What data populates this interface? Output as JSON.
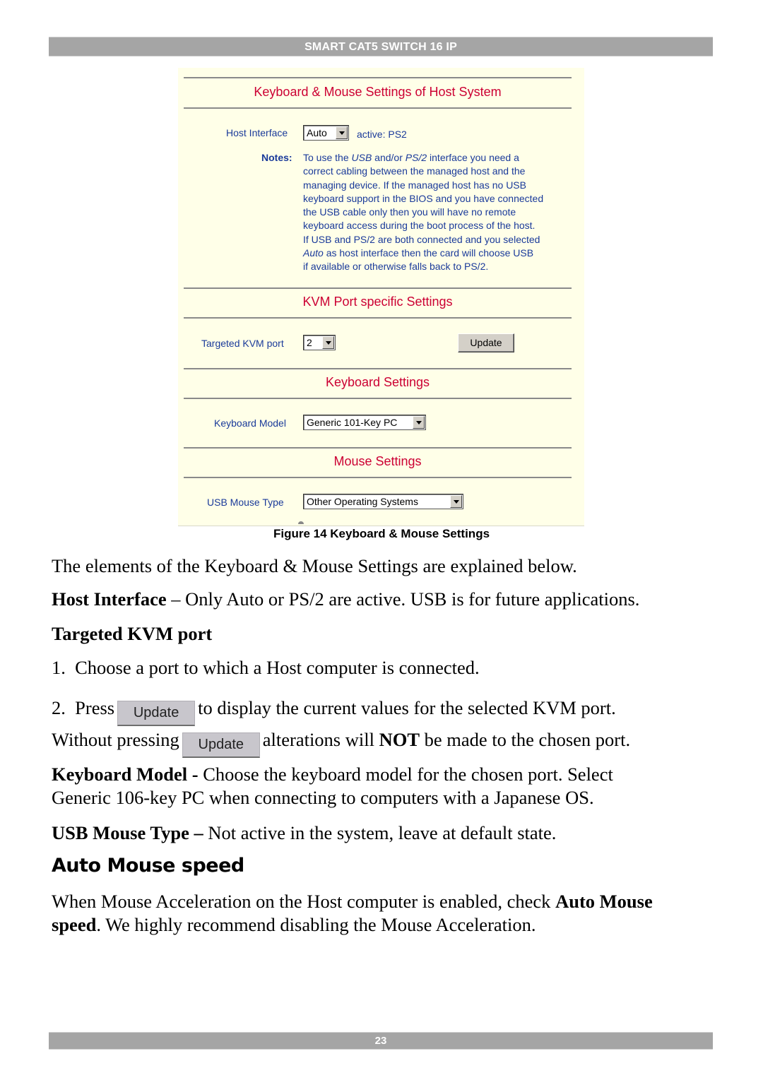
{
  "header": {
    "title": "SMART CAT5 SWITCH 16 IP"
  },
  "figure": {
    "sections": {
      "host": {
        "title": "Keyboard & Mouse Settings of Host System"
      },
      "kvm": {
        "title": "KVM Port specific Settings"
      },
      "keyboard": {
        "title": "Keyboard Settings"
      },
      "mouse": {
        "title": "Mouse Settings"
      }
    },
    "host_interface": {
      "label": "Host Interface",
      "value": "Auto",
      "active_text": "active: PS2"
    },
    "notes": {
      "label": "Notes:",
      "lines": [
        "To use the USB and/or PS/2 interface you need a",
        "correct cabling between the managed host and the",
        "managing device. If the managed host has no USB",
        "keyboard support in the BIOS and you have connected",
        "the USB cable only then you will have no remote",
        "keyboard access during the boot process of the host.",
        "If USB and PS/2 are both connected and you selected",
        "Auto as host interface then the card will choose USB",
        "if available or otherwise falls back to PS/2."
      ]
    },
    "targeted_kvm_port": {
      "label": "Targeted KVM port",
      "value": "2",
      "button_label": "Update"
    },
    "keyboard_model": {
      "label": "Keyboard Model",
      "value": "Generic 101-Key PC"
    },
    "usb_mouse_type": {
      "label": "USB Mouse Type",
      "value": "Other Operating Systems"
    },
    "caption": "Figure 14 Keyboard & Mouse Settings"
  },
  "body": {
    "intro": "The elements of the Keyboard & Mouse Settings are explained below.",
    "host_interface": {
      "term": "Host Interface",
      "text": " – Only Auto or PS/2 are active. USB is for future applications."
    },
    "targeted_heading": "Targeted KVM port",
    "step1": "1.  Choose a port to which a Host computer is connected.",
    "step2": {
      "prefix": "2.  Press",
      "button": "Update",
      "suffix": "to display the current values for the selected KVM port."
    },
    "without": {
      "prefix": "Without pressing",
      "button": "Update",
      "mid": "alterations will ",
      "bold": "NOT",
      "suffix": " be made to the chosen port."
    },
    "keyboard_model": {
      "term": "Keyboard Model - ",
      "line1": "Choose the keyboard model for the chosen port. Select",
      "line2": "Generic 106-key PC when connecting to computers with a Japanese OS."
    },
    "usb_mouse": {
      "term": "USB Mouse Type – ",
      "text": "Not active in the system, leave at default state."
    },
    "auto_mouse_heading": "Auto Mouse speed",
    "auto_mouse": {
      "pre": "When Mouse Acceleration on the Host computer is enabled, check ",
      "bold1": "Auto Mouse",
      "bold2": "speed",
      "post": ". We highly recommend disabling the Mouse Acceleration."
    }
  },
  "footer": {
    "page_number": "23"
  }
}
